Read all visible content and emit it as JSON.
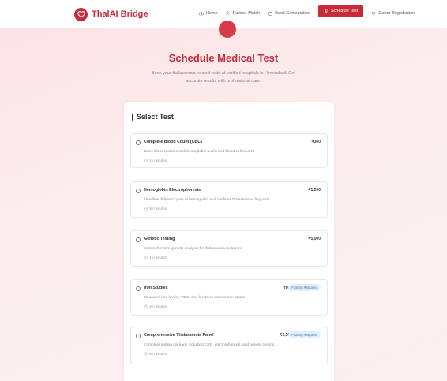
{
  "brand": {
    "name": "ThalAI Bridge",
    "color": "#c92a3b"
  },
  "nav": {
    "links": [
      {
        "label": "Home",
        "icon": "home-icon",
        "active": false
      },
      {
        "label": "Partner Match",
        "icon": "users-icon",
        "active": false
      },
      {
        "label": "Book Consultation",
        "icon": "calendar-icon",
        "active": false
      },
      {
        "label": "Schedule Test",
        "icon": "test-tube-icon",
        "active": true
      },
      {
        "label": "Donor Registration",
        "icon": "heart-hand-icon",
        "active": false
      }
    ]
  },
  "header": {
    "title": "Schedule Medical Test",
    "subtitle": "Book your thalassemia related tests at verified hospitals in Hyderabad. Get accurate results with professional care."
  },
  "section": {
    "title": "Select Test"
  },
  "tests": [
    {
      "name": "Complete Blood Count (CBC)",
      "price": "₹300",
      "desc": "Basic blood test to check hemoglobin levels and blood cell counts",
      "duration": "15 minutes",
      "badge": ""
    },
    {
      "name": "Hemoglobin Electrophoresis",
      "price": "₹1,200",
      "desc": "Identifies different types of hemoglobin and confirms thalassemia diagnosis",
      "duration": "30 minutes",
      "badge": ""
    },
    {
      "name": "Genetic Testing",
      "price": "₹5,000",
      "desc": "Comprehensive genetic analysis for thalassemia mutations",
      "duration": "45 minutes",
      "badge": ""
    },
    {
      "name": "Iron Studies",
      "price": "₹800",
      "desc": "Measures iron levels, TIBC, and ferritin to assess iron status",
      "duration": "20 minutes",
      "badge": "Fasting Required"
    },
    {
      "name": "Comprehensive Thalassemia Panel",
      "price": "₹3,500",
      "desc": "Complete testing package including CBC, electrophoresis, and genetic testing",
      "duration": "60 minutes",
      "badge": "Fasting Required"
    }
  ]
}
